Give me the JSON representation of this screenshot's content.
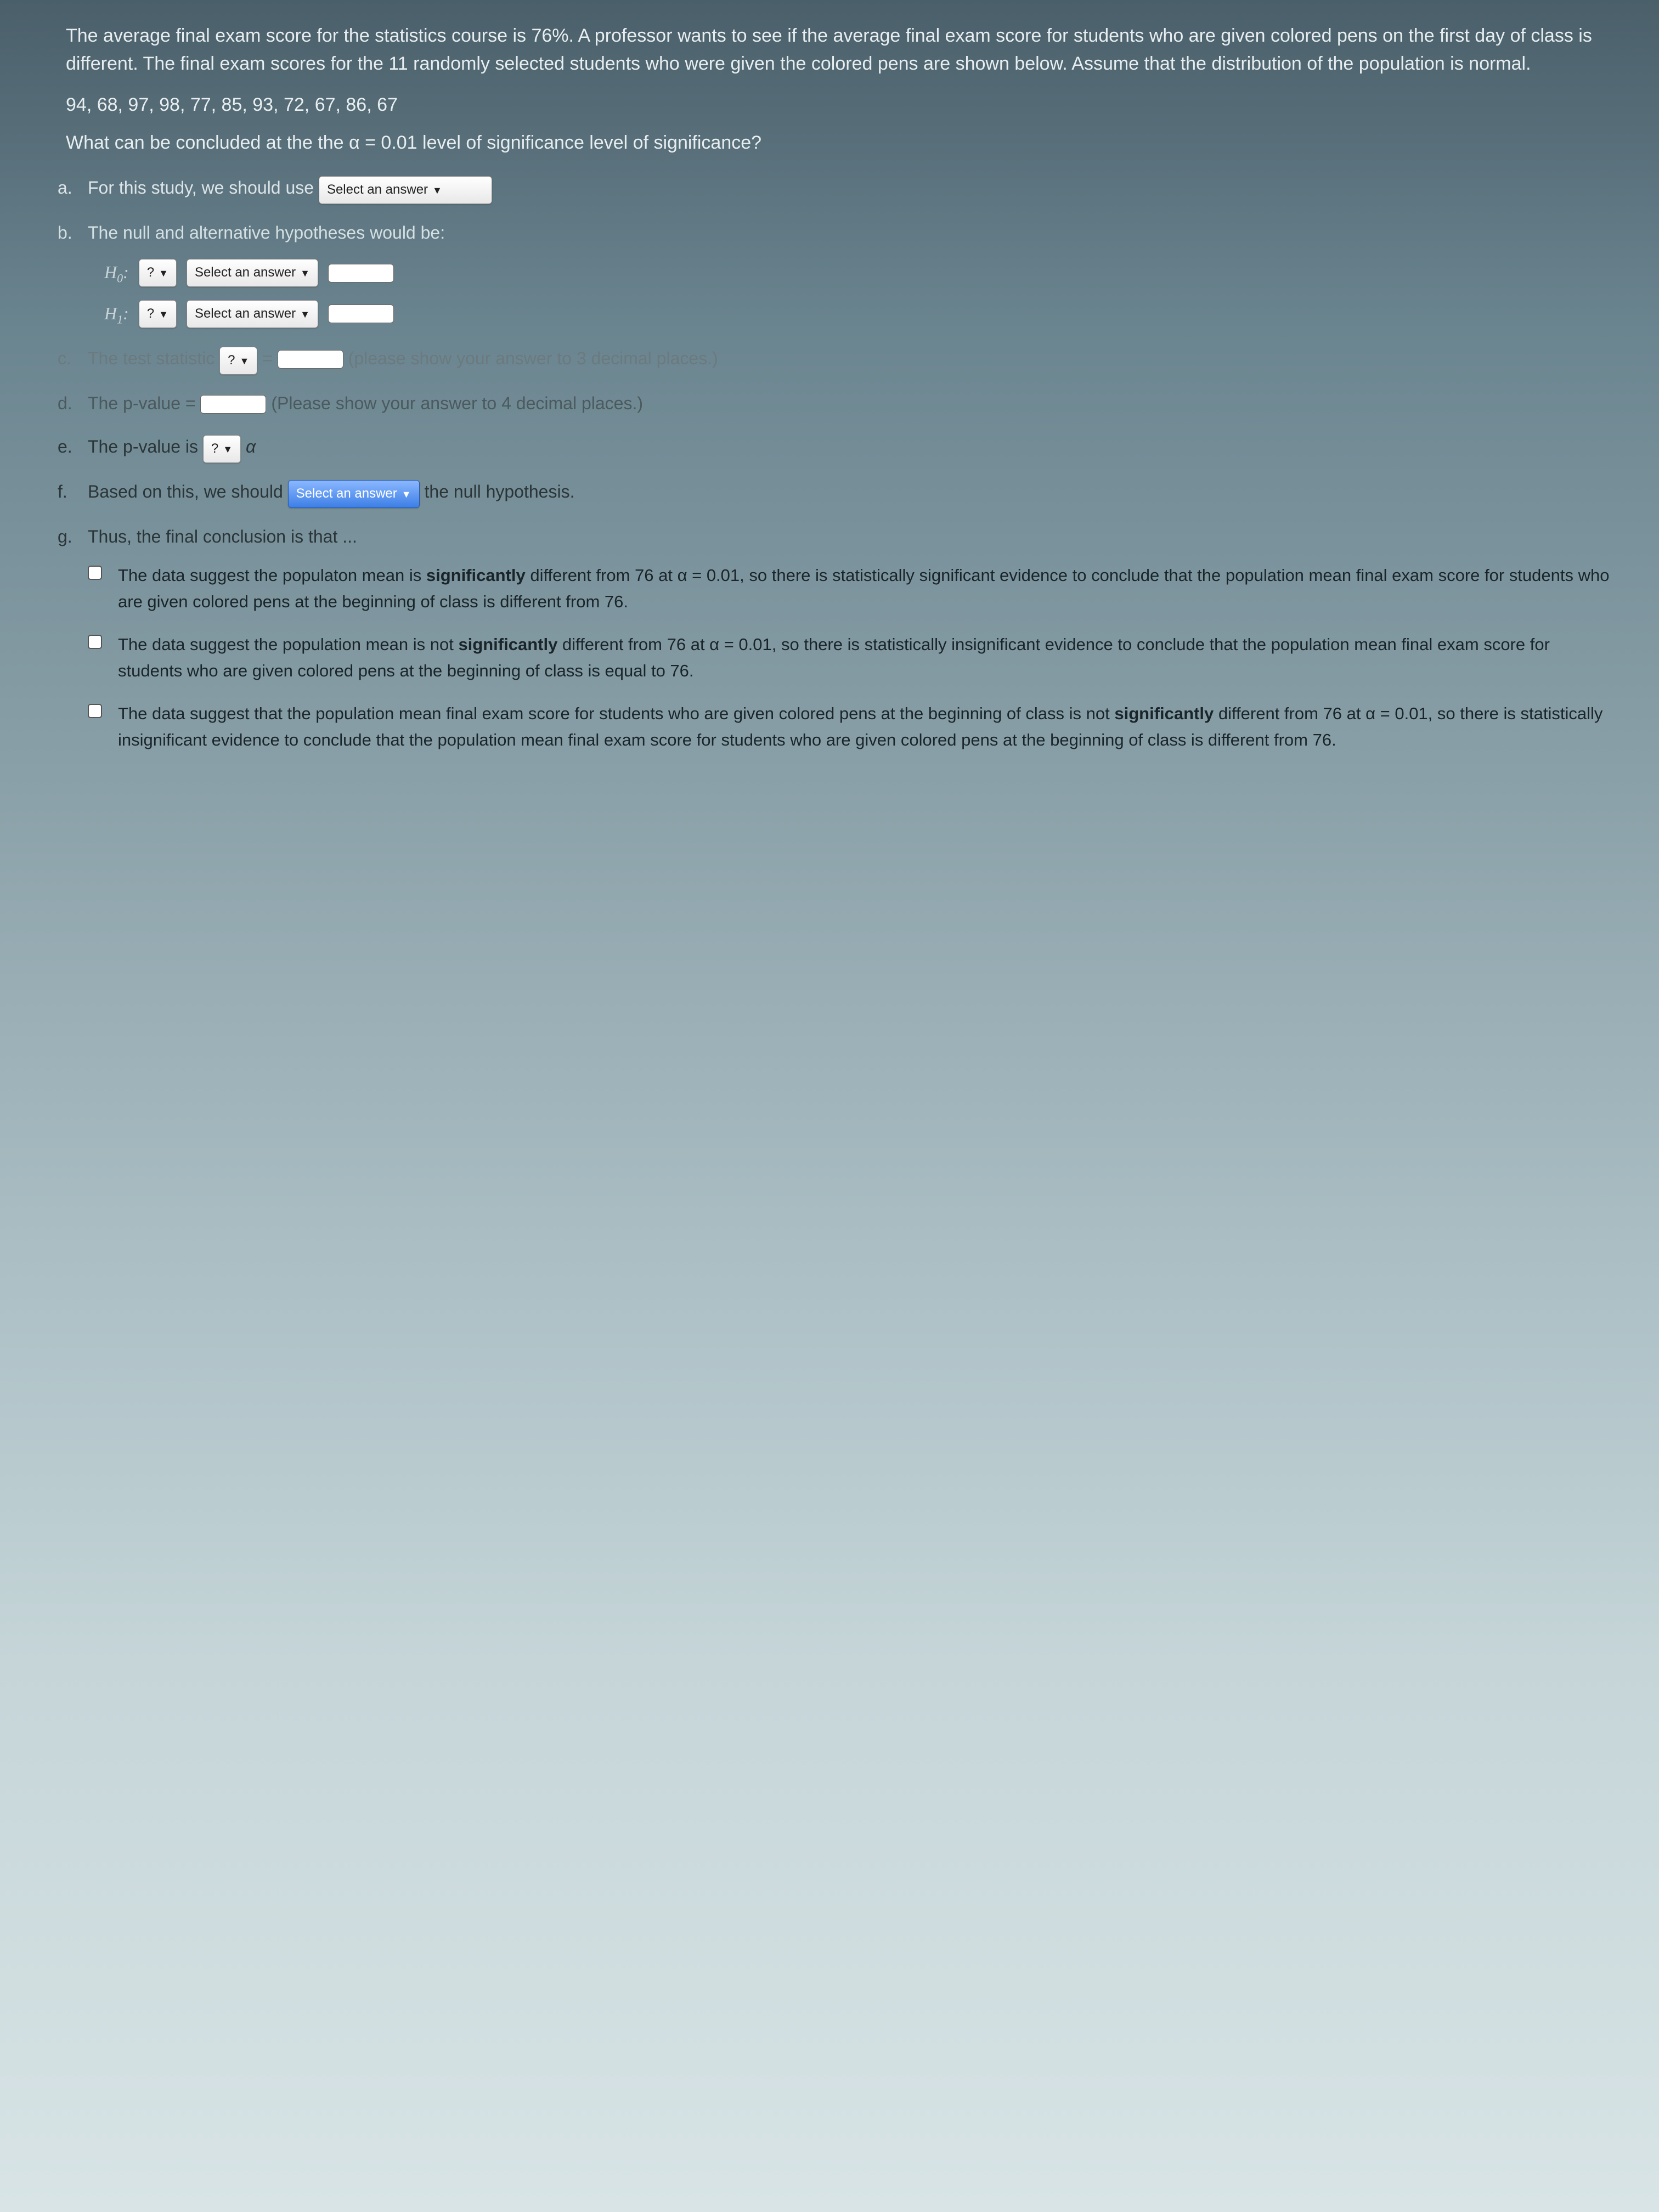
{
  "intro": "The average final exam score for the statistics course is 76%. A professor wants to see if the average final exam score for students who are given colored pens on the first day of class is different. The final exam scores for the 11 randomly selected students who were given the colored pens are shown below. Assume that the distribution of the population is normal.",
  "data_values": "94, 68, 97, 98, 77, 85, 93, 72, 67, 86, 67",
  "main_question": "What can be concluded at the the α = 0.01 level of significance level of significance?",
  "items": {
    "a": {
      "marker": "a.",
      "text_before": "For this study, we should use ",
      "select": "Select an answer"
    },
    "b": {
      "marker": "b.",
      "text": "The null and alternative hypotheses would be:",
      "h0_label": "H₀:",
      "h1_label": "H₁:",
      "q": "?",
      "sel": "Select an answer"
    },
    "c": {
      "marker": "c.",
      "before": "The test statistic ",
      "q": "?",
      "eq": " = ",
      "after": " (please show your answer to 3 decimal places.)"
    },
    "d": {
      "marker": "d.",
      "before": "The p-value = ",
      "after": " (Please show your answer to 4 decimal places.)"
    },
    "e": {
      "marker": "e.",
      "before": "The p-value is ",
      "q": "?",
      "after": " α"
    },
    "f": {
      "marker": "f.",
      "before": "Based on this, we should ",
      "sel": "Select an answer",
      "after": " the null hypothesis."
    },
    "g": {
      "marker": "g.",
      "text": "Thus, the final conclusion is that ..."
    }
  },
  "options": {
    "opt1_a": "The data suggest the populaton mean is ",
    "opt1_b": "significantly",
    "opt1_c": " different from 76 at α = 0.01, so there is statistically significant evidence to conclude that the population mean final exam score for students who are given colored pens at the beginning of class is different from 76.",
    "opt2_a": "The data suggest the population mean is not ",
    "opt2_b": "significantly",
    "opt2_c": " different from 76 at α = 0.01, so there is statistically insignificant evidence to conclude that the population mean final exam score for students who are given colored pens at the beginning of class is equal to 76.",
    "opt3_a": "The data suggest that the population mean final exam score for students who are given colored pens at the beginning of class is not ",
    "opt3_b": "significantly",
    "opt3_c": " different from 76 at α = 0.01, so there is statistically insignificant evidence to conclude that the population mean final exam score for students who are given colored pens at the beginning of class is different from 76."
  }
}
